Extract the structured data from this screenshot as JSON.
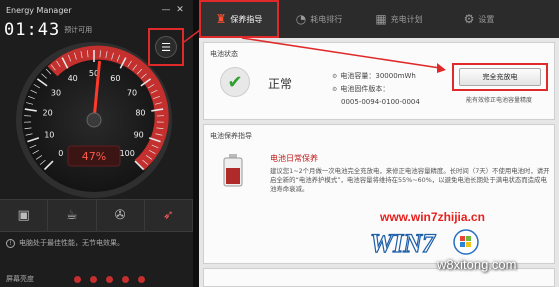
{
  "app": {
    "title": "Energy Manager",
    "window_buttons": [
      "—",
      "✕"
    ],
    "time": "01:43",
    "time_caption": "预计可用",
    "gauge": {
      "ticks": [
        "0",
        "10",
        "20",
        "30",
        "40",
        "50",
        "60",
        "70",
        "80",
        "90",
        "100"
      ],
      "value_label": "47%",
      "needle_value": 52
    },
    "menu_icon": "list-icon",
    "modes": [
      {
        "name": "presentation-mode-icon",
        "glyph": "▣",
        "active": false
      },
      {
        "name": "cup-icon",
        "glyph": "☕",
        "active": false
      },
      {
        "name": "film-icon",
        "glyph": "⌘",
        "active": false
      },
      {
        "name": "rocket-icon",
        "glyph": "🚀",
        "active": true
      }
    ],
    "tip": "电脑处于最佳性能，无节电效果。",
    "brightness_label": "屏幕亮度",
    "brightness_dots": 5
  },
  "nav": {
    "tabs": [
      {
        "label": "保养指导",
        "icon": "battery-care-icon",
        "glyph": "🧯",
        "active": true
      },
      {
        "label": "耗电排行",
        "icon": "chart-icon",
        "glyph": "◔",
        "active": false
      },
      {
        "label": "充电计划",
        "icon": "calendar-icon",
        "glyph": "▦",
        "active": false
      },
      {
        "label": "设置",
        "icon": "gear-icon",
        "glyph": "⚙",
        "active": false
      }
    ]
  },
  "status": {
    "section_title": "电池状态",
    "state": "正常",
    "capacity_label": "电池容量：30000mWh",
    "firmware_label": "电池固件版本：",
    "firmware_value": "0005-0094-0100-0004",
    "calibrate_button": "完全充放电",
    "calibrate_note": "能有效修正电池容量精度"
  },
  "care": {
    "section_title": "电池保养指导",
    "title": "电池日常保养",
    "text": "建议您1~2个月做一次电池完全充放电，来修正电池容量精度。长时间（7天）不使用电池时，请开启全新的“电池养护模式”，电池容量将维持在55%~60%，以避免电池长期处于满电状态而造成电池寿命衰减。"
  },
  "watermark": {
    "url": "www.win7zhijia.cn",
    "logo_text": "WIN7",
    "site": "w8xitong.com"
  },
  "colors": {
    "accent_red": "#e02a2a",
    "gauge_red": "#c3302d",
    "ok_green": "#2ea12e"
  }
}
